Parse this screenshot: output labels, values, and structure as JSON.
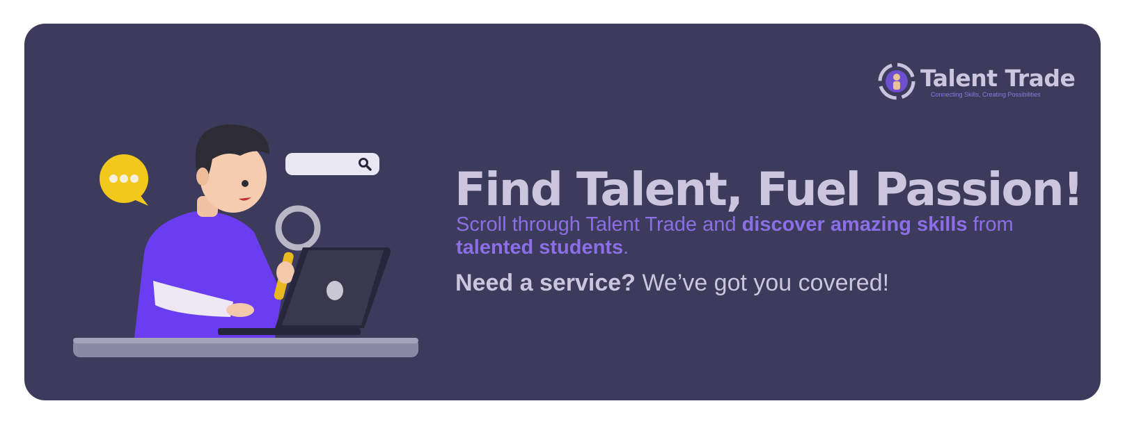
{
  "brand": {
    "name": "Talent Trade",
    "tagline": "Connecting Skills, Creating Possibilities"
  },
  "hero": {
    "headline": "Find Talent, Fuel Passion!",
    "subtext": {
      "part1": "Scroll through Talent Trade and ",
      "highlight1": "discover amazing skills",
      "part2": " from ",
      "highlight2": "talented students",
      "part3": "."
    },
    "cta": {
      "strong": "Need a service?",
      "rest": " We’ve got you covered!"
    }
  },
  "colors": {
    "banner_bg": "#3c3b5c",
    "headline": "#ccc5de",
    "accent": "#8c6fe6",
    "shirt": "#6a3df0",
    "bubble": "#f2c81c"
  },
  "icons": [
    "chat-bubble-icon",
    "search-icon",
    "magnifying-glass-icon",
    "laptop-icon",
    "logo-mark-icon"
  ]
}
